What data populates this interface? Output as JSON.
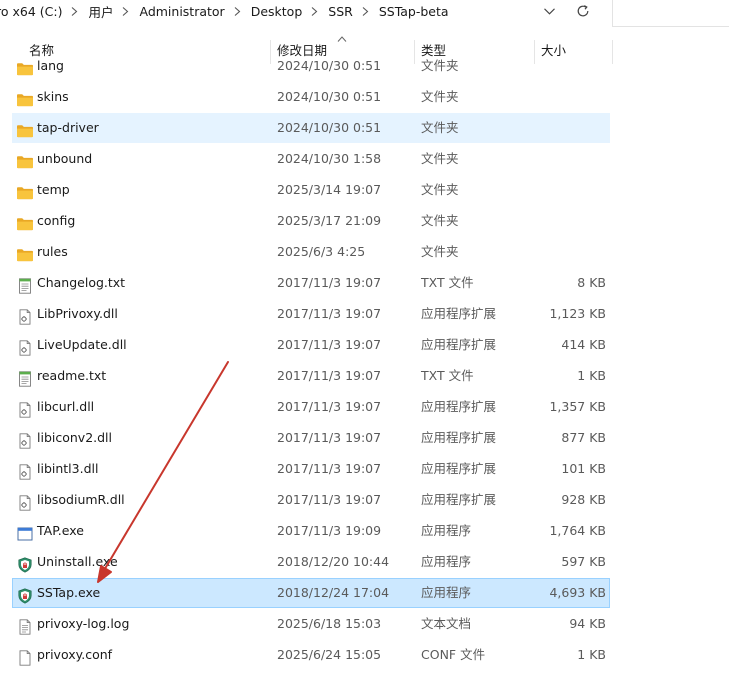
{
  "breadcrumb": [
    "ro x64 (C:)",
    "用户",
    "Administrator",
    "Desktop",
    "SSR",
    "SSTap-beta"
  ],
  "columns": {
    "name": "名称",
    "date": "修改日期",
    "type": "类型",
    "size": "大小"
  },
  "files": [
    {
      "name": "lang",
      "date": "2024/10/30 0:51",
      "type": "文件夹",
      "size": "",
      "icon": "folder-icon",
      "state": "partial"
    },
    {
      "name": "skins",
      "date": "2024/10/30 0:51",
      "type": "文件夹",
      "size": "",
      "icon": "folder-icon",
      "state": ""
    },
    {
      "name": "tap-driver",
      "date": "2024/10/30 0:51",
      "type": "文件夹",
      "size": "",
      "icon": "folder-icon",
      "state": "hover"
    },
    {
      "name": "unbound",
      "date": "2024/10/30 1:58",
      "type": "文件夹",
      "size": "",
      "icon": "folder-icon",
      "state": ""
    },
    {
      "name": "temp",
      "date": "2025/3/14 19:07",
      "type": "文件夹",
      "size": "",
      "icon": "folder-icon",
      "state": ""
    },
    {
      "name": "config",
      "date": "2025/3/17 21:09",
      "type": "文件夹",
      "size": "",
      "icon": "folder-icon",
      "state": ""
    },
    {
      "name": "rules",
      "date": "2025/6/3 4:25",
      "type": "文件夹",
      "size": "",
      "icon": "folder-icon",
      "state": ""
    },
    {
      "name": "Changelog.txt",
      "date": "2017/11/3 19:07",
      "type": "TXT 文件",
      "size": "8 KB",
      "icon": "txt-file-icon",
      "state": ""
    },
    {
      "name": "LibPrivoxy.dll",
      "date": "2017/11/3 19:07",
      "type": "应用程序扩展",
      "size": "1,123 KB",
      "icon": "dll-file-icon",
      "state": ""
    },
    {
      "name": "LiveUpdate.dll",
      "date": "2017/11/3 19:07",
      "type": "应用程序扩展",
      "size": "414 KB",
      "icon": "dll-file-icon",
      "state": ""
    },
    {
      "name": "readme.txt",
      "date": "2017/11/3 19:07",
      "type": "TXT 文件",
      "size": "1 KB",
      "icon": "txt-file-icon",
      "state": ""
    },
    {
      "name": "libcurl.dll",
      "date": "2017/11/3 19:07",
      "type": "应用程序扩展",
      "size": "1,357 KB",
      "icon": "dll-file-icon",
      "state": ""
    },
    {
      "name": "libiconv2.dll",
      "date": "2017/11/3 19:07",
      "type": "应用程序扩展",
      "size": "877 KB",
      "icon": "dll-file-icon",
      "state": ""
    },
    {
      "name": "libintl3.dll",
      "date": "2017/11/3 19:07",
      "type": "应用程序扩展",
      "size": "101 KB",
      "icon": "dll-file-icon",
      "state": ""
    },
    {
      "name": "libsodiumR.dll",
      "date": "2017/11/3 19:07",
      "type": "应用程序扩展",
      "size": "928 KB",
      "icon": "dll-file-icon",
      "state": ""
    },
    {
      "name": "TAP.exe",
      "date": "2017/11/3 19:09",
      "type": "应用程序",
      "size": "1,764 KB",
      "icon": "app-window-icon",
      "state": ""
    },
    {
      "name": "Uninstall.exe",
      "date": "2018/12/20 10:44",
      "type": "应用程序",
      "size": "597 KB",
      "icon": "shield-icon",
      "state": ""
    },
    {
      "name": "SSTap.exe",
      "date": "2018/12/24 17:04",
      "type": "应用程序",
      "size": "4,693 KB",
      "icon": "shield-icon",
      "state": "selected"
    },
    {
      "name": "privoxy-log.log",
      "date": "2025/6/18 15:03",
      "type": "文本文档",
      "size": "94 KB",
      "icon": "text-doc-icon",
      "state": ""
    },
    {
      "name": "privoxy.conf",
      "date": "2025/6/24 15:05",
      "type": "CONF 文件",
      "size": "1 KB",
      "icon": "blank-file-icon",
      "state": ""
    }
  ],
  "colors": {
    "hover": "#e5f3ff",
    "selected": "#cce8ff",
    "folder": "#f8c43d",
    "arrow": "#c8372d"
  }
}
